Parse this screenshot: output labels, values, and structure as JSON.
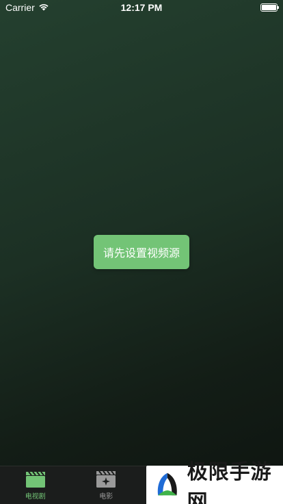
{
  "status_bar": {
    "carrier": "Carrier",
    "time": "12:17 PM"
  },
  "toast": {
    "message": "请先设置视频源"
  },
  "tab_bar": {
    "tabs": [
      {
        "label": "电视剧",
        "icon": "clapperboard-icon",
        "active": true
      },
      {
        "label": "电影",
        "icon": "film-sparkle-icon",
        "active": false
      },
      {
        "label": "",
        "icon": "tab-icon",
        "active": false
      },
      {
        "label": "",
        "icon": "tab-icon",
        "active": false
      }
    ]
  },
  "watermark": {
    "text": "极限手游网"
  },
  "colors": {
    "accent": "#73c476",
    "tab_bar_bg": "#1b1d1c",
    "inactive": "#9a9a9a"
  }
}
